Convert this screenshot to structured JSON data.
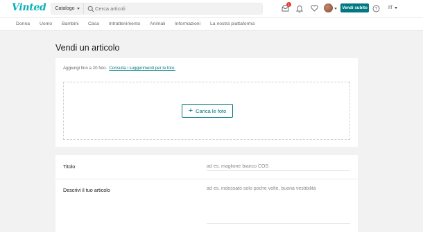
{
  "header": {
    "logo": "Vinted",
    "catalog_label": "Catalogo",
    "search_placeholder": "Cerca articoli",
    "notification_count": "1",
    "sell_button": "Vendi subito",
    "language": "IT"
  },
  "categories": [
    "Donna",
    "Uomo",
    "Bambini",
    "Casa",
    "Intrattenimento",
    "Animali",
    "Informazioni",
    "La nostra piattaforma"
  ],
  "page": {
    "title": "Vendi un articolo",
    "photo_hint": "Aggiungi fino a 20 foto.",
    "photo_hint_link": "Consulta i suggerimenti per le foto.",
    "upload_button": "Carica le foto"
  },
  "form": {
    "title_label": "Titolo",
    "title_placeholder": "ad es. maglione bianco COS",
    "description_label": "Descrivi il tuo articolo",
    "description_placeholder": "ad es. indossato solo poche volte, buona vestibilità"
  },
  "colors": {
    "brand": "#09b1ba",
    "accent": "#007782",
    "badge": "#e53935"
  }
}
